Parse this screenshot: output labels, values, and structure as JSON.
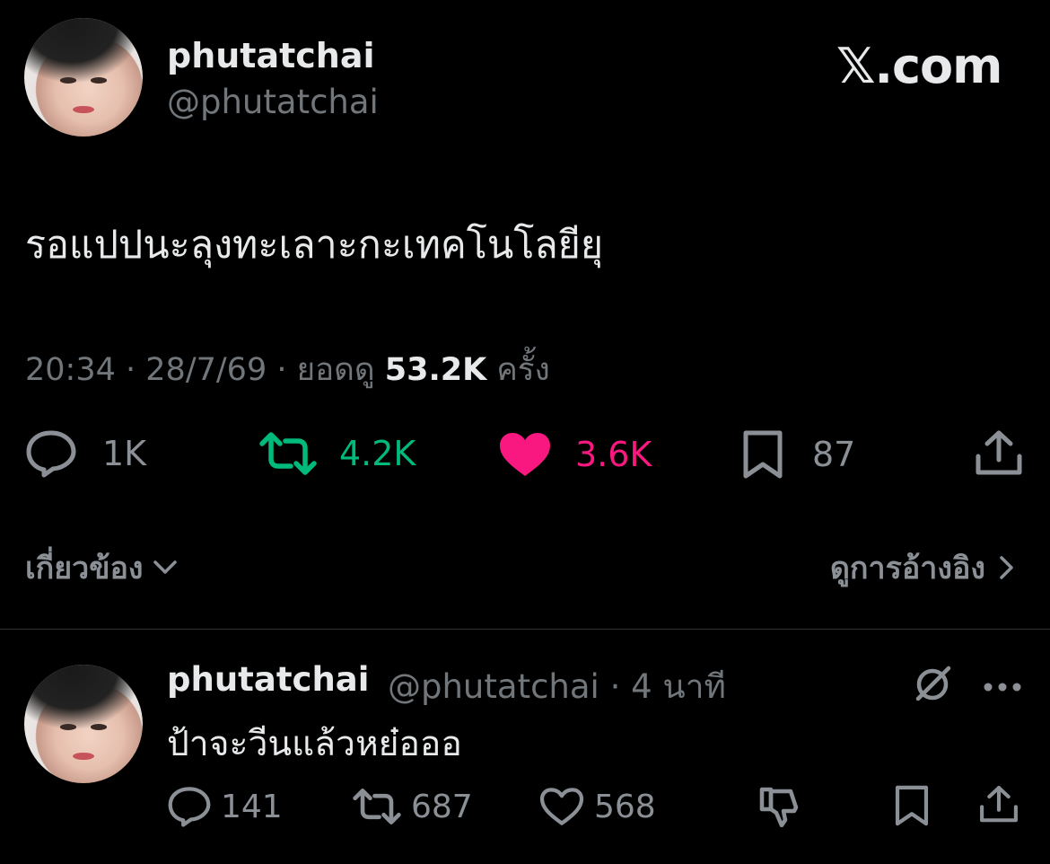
{
  "post": {
    "display_name": "phutatchai",
    "handle": "@phutatchai",
    "brand": "𝕏.com",
    "text": "รอแปปนะลุงทะเลาะกะเทคโนโลยียุ",
    "time": "20:34",
    "date": "28/7/69",
    "views_label": "ยอดดู",
    "views": "53.2K",
    "views_unit": "ครั้ง",
    "actions": {
      "reply_count": "1K",
      "repost_count": "4.2K",
      "like_count": "3.6K",
      "bookmark_count": "87"
    },
    "related_label": "เกี่ยวข้อง",
    "view_quotes_label": "ดูการอ้างอิง"
  },
  "reply": {
    "display_name": "phutatchai",
    "handle": "@phutatchai",
    "age": "4 นาที",
    "text": "ป้าจะวีนแล้วหย๋อออ",
    "actions": {
      "reply_count": "141",
      "repost_count": "687",
      "like_count": "568"
    }
  },
  "colors": {
    "background": "#000000",
    "text": "#e7e9ea",
    "muted": "#71767b",
    "repost": "#00ba7c",
    "like": "#f91880"
  }
}
